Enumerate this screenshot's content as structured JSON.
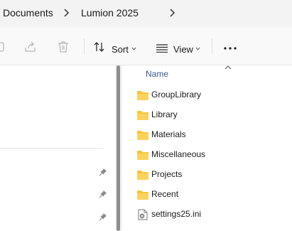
{
  "breadcrumb": {
    "items": [
      "Documents",
      "Lumion 2025"
    ]
  },
  "toolbar": {
    "sort_label": "Sort",
    "view_label": "View",
    "more_glyph": "•••"
  },
  "file_list": {
    "column_name": "Name",
    "items": [
      {
        "name": "GroupLibrary",
        "type": "folder"
      },
      {
        "name": "Library",
        "type": "folder"
      },
      {
        "name": "Materials",
        "type": "folder"
      },
      {
        "name": "Miscellaneous",
        "type": "folder"
      },
      {
        "name": "Projects",
        "type": "folder"
      },
      {
        "name": "Recent",
        "type": "folder"
      },
      {
        "name": "settings25.ini",
        "type": "ini-file"
      }
    ]
  },
  "colors": {
    "folder": "#f8c537",
    "header_text": "#3a5a8c"
  }
}
